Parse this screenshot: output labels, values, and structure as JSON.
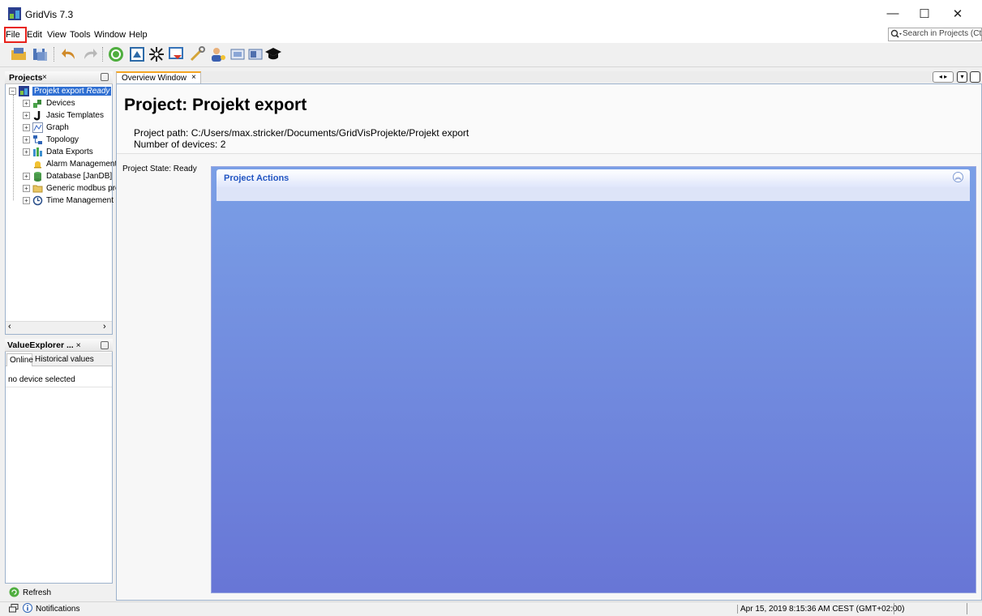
{
  "window": {
    "title": "GridVis 7.3"
  },
  "menu": {
    "items": [
      "File",
      "Edit",
      "View",
      "Tools",
      "Window",
      "Help"
    ],
    "search_placeholder": "Search in Projects (Ctrl+I)"
  },
  "projects_panel": {
    "tab_label": "Projects",
    "close_glyph": "×",
    "root": {
      "label": "Projekt export",
      "status": "Ready"
    },
    "items": [
      {
        "label": "Devices",
        "icon": "devices-icon"
      },
      {
        "label": "Jasic Templates",
        "icon": "jasic-icon"
      },
      {
        "label": "Graph",
        "icon": "graph-icon"
      },
      {
        "label": "Topology",
        "icon": "topology-icon"
      },
      {
        "label": "Data Exports",
        "icon": "data-exports-icon"
      },
      {
        "label": "Alarm Management",
        "icon": "bell-icon"
      },
      {
        "label": "Database [JanDB]",
        "icon": "database-icon"
      },
      {
        "label": "Generic modbus pro",
        "icon": "folder-icon"
      },
      {
        "label": "Time Management",
        "icon": "time-icon"
      }
    ]
  },
  "value_explorer": {
    "tab_label": "ValueExplorer ...",
    "close_glyph": "×",
    "tabs": [
      "Online",
      "Historical values"
    ],
    "empty_text": "no device selected",
    "refresh_label": "Refresh"
  },
  "overview": {
    "tab_label": "Overview Window",
    "close_glyph": "×",
    "title": "Project: Projekt export",
    "path_line": "Project path: C:/Users/max.stricker/Documents/GridVisProjekte/Projekt export",
    "devices_line": "Number of devices: 2",
    "state_line": "Project State: Ready",
    "actions_title": "Project Actions"
  },
  "statusbar": {
    "notifications_label": "Notifications",
    "datetime": "Apr 15, 2019 8:15:36 AM CEST (GMT+02:00)"
  },
  "colors": {
    "selection": "#2f6fd2",
    "actions_gradient_top": "#7a9fe6",
    "actions_gradient_bottom": "#6876d6",
    "highlight_box": "#e8211a"
  }
}
